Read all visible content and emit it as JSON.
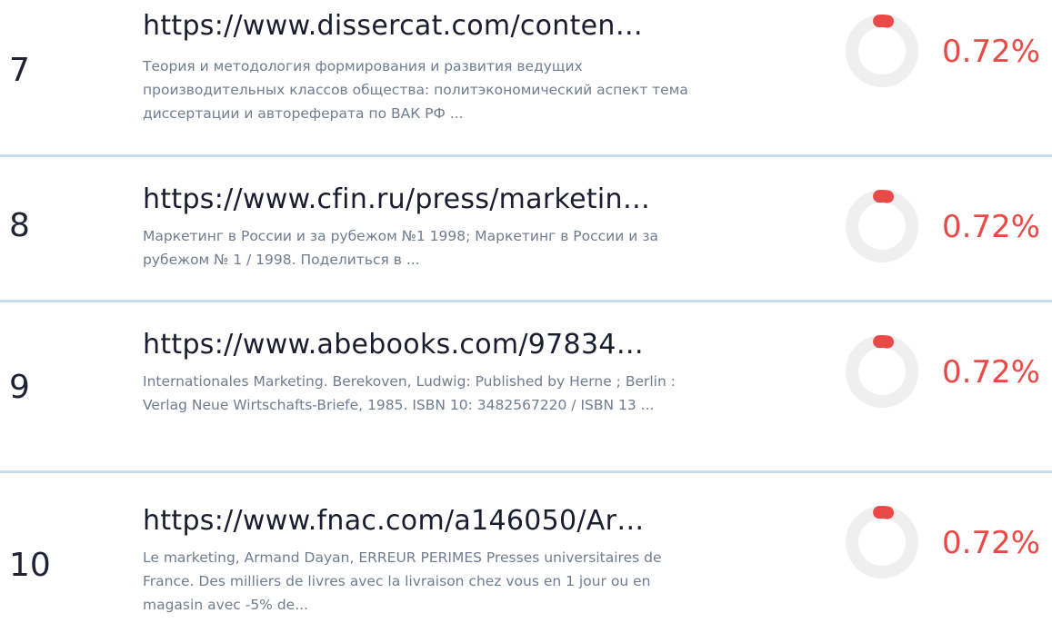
{
  "results": [
    {
      "rank": "7",
      "url": "https://www.dissercat.com/conten…",
      "description": "Теория и методология формирования и развития ведущих производительных классов общества: политэкономический аспект тема диссертации и автореферата по ВАК РФ ...",
      "percent": "0.72%",
      "fraction": 0.0072
    },
    {
      "rank": "8",
      "url": "https://www.cfin.ru/press/marketin…",
      "description": "Маркетинг в России и за рубежом №1 1998; Маркетинг в России и за рубежом № 1 / 1998. Поделиться в ...",
      "percent": "0.72%",
      "fraction": 0.0072
    },
    {
      "rank": "9",
      "url": "https://www.abebooks.com/97834…",
      "description": "Internationales Marketing. Berekoven, Ludwig: Published by Herne ; Berlin : Verlag Neue Wirtschafts-Briefe, 1985. ISBN 10: 3482567220 / ISBN 13 ...",
      "percent": "0.72%",
      "fraction": 0.0072
    },
    {
      "rank": "10",
      "url": "https://www.fnac.com/a146050/Ar…",
      "description": "Le marketing, Armand Dayan, ERREUR PERIMES Presses universitaires de France. Des milliers de livres avec la livraison chez vous en 1 jour ou en magasin avec -5% de...",
      "percent": "0.72%",
      "fraction": 0.0072
    }
  ],
  "colors": {
    "accent": "#ea4a47",
    "track": "#efefef",
    "divider": "#c9dceb"
  }
}
